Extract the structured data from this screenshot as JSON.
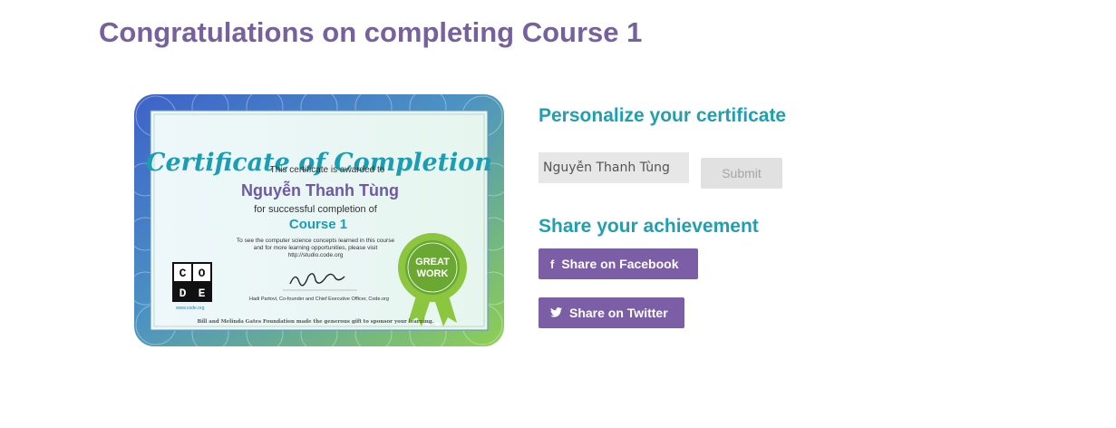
{
  "page": {
    "title": "Congratulations on completing Course 1"
  },
  "certificate": {
    "heading": "Certificate of Completion",
    "awarded_text": "This certificate is awarded to",
    "recipient": "Nguyễn Thanh Tùng",
    "completion_text": "for successful completion of",
    "course": "Course 1",
    "info_line1": "To see the computer science concepts learned in this course",
    "info_line2": "and for more learning opportunities, please visit",
    "info_url": "http://studio.code.org",
    "logo_letters": [
      "C",
      "O",
      "D",
      "E"
    ],
    "logo_url": "www.code.org",
    "signer_line": "Hadi Partovi, Co-founder and Chief Executive Officer, Code.org",
    "badge_text_top": "GREAT",
    "badge_text_bottom": "WORK",
    "footer": "Bill and Melinda Gates Foundation made the generous gift to sponsor your learning."
  },
  "personalize": {
    "heading": "Personalize your certificate",
    "name_value": "Nguyễn Thanh Tùng",
    "submit_label": "Submit"
  },
  "share": {
    "heading": "Share your achievement",
    "facebook_label": "Share on Facebook",
    "facebook_icon": "f",
    "twitter_label": "Share on Twitter",
    "twitter_icon": "🐦"
  },
  "colors": {
    "title": "#76609e",
    "heading_teal": "#1fa0b1",
    "button_purple": "#7c5ea7",
    "submit_bg": "#e1e1e1"
  }
}
